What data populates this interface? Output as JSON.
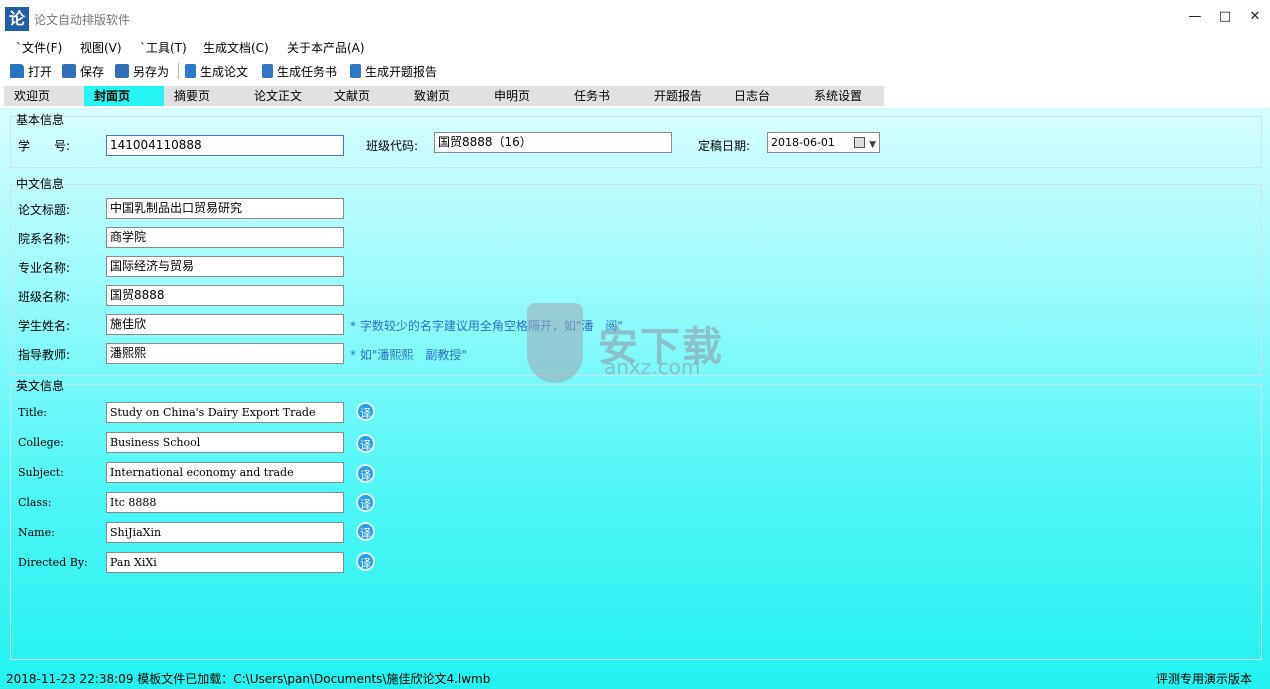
{
  "window": {
    "title": "论文自动排版软件",
    "icon_glyph": "论",
    "minimize_glyph": "—",
    "maximize_glyph": "□",
    "close_glyph": "✕"
  },
  "menu": [
    "`文件(F)",
    "视图(V)",
    "`工具(T)",
    "生成文档(C)",
    "关于本产品(A)"
  ],
  "toolbar": {
    "open": "打开",
    "save": "保存",
    "save_as": "另存为",
    "gen_paper": "生成论文",
    "gen_task": "生成任务书",
    "gen_report": "生成开题报告"
  },
  "tabs": [
    "欢迎页",
    "封面页",
    "摘要页",
    "论文正文",
    "文献页",
    "致谢页",
    "申明页",
    "任务书",
    "开题报告",
    "日志台",
    "系统设置"
  ],
  "active_tab": "封面页",
  "basic": {
    "title": "基本信息",
    "student_id_label": "学　　号:",
    "student_id": "141004110888",
    "class_code_label": "班级代码:",
    "class_code": "国贸8888（16）",
    "date_label": "定稿日期:",
    "date": "2018-06-01"
  },
  "chinese": {
    "title": "中文信息",
    "fields": [
      {
        "label": "论文标题:",
        "value": "中国乳制品出口贸易研究",
        "hint": ""
      },
      {
        "label": "院系名称:",
        "value": "商学院",
        "hint": ""
      },
      {
        "label": "专业名称:",
        "value": "国际经济与贸易",
        "hint": ""
      },
      {
        "label": "班级名称:",
        "value": "国贸8888",
        "hint": ""
      },
      {
        "label": "学生姓名:",
        "value": "施佳欣",
        "hint": "* 字数较少的名字建议用全角空格隔开，如\"潘　阅\""
      },
      {
        "label": "指导教师:",
        "value": "潘熙熙",
        "hint": "* 如\"潘熙熙　副教授\""
      }
    ]
  },
  "english": {
    "title": "英文信息",
    "translate_glyph": "译",
    "fields": [
      {
        "label": "Title:",
        "value": "Study on China's Dairy Export Trade"
      },
      {
        "label": "College:",
        "value": "Business School"
      },
      {
        "label": "Subject:",
        "value": "International economy and trade"
      },
      {
        "label": "Class:",
        "value": "Itc 8888"
      },
      {
        "label": "Name:",
        "value": "ShiJiaXin"
      },
      {
        "label": "Directed By:",
        "value": "Pan XiXi"
      }
    ]
  },
  "watermark": {
    "main": "安下载",
    "sub": "anxz.com"
  },
  "status": {
    "left": "2018-11-23 22:38:09   模板文件已加载：C:\\Users\\pan\\Documents\\施佳欣论文4.lwmb",
    "right": "评测专用演示版本"
  }
}
